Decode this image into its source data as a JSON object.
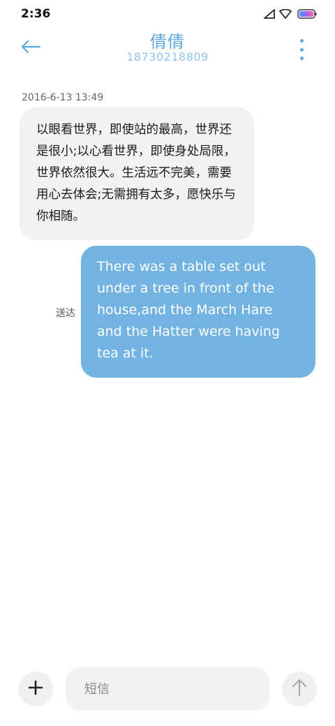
{
  "status_bar": {
    "time": "2:36",
    "icons": [
      "cellular-signal-icon",
      "wifi-icon",
      "battery-icon"
    ]
  },
  "header": {
    "contact_name": "倩倩",
    "contact_number": "18730218809",
    "back_icon": "arrow-left-icon",
    "more_icon": "more-vertical-icon"
  },
  "conversation": {
    "timestamp": "2016-6-13 13:49",
    "messages": [
      {
        "direction": "incoming",
        "text": "以眼看世界，即使站的最高，世界还是很小;以心看世界，即使身处局限，世界依然很大。生活远不完美，需要用心去体会;无需拥有太多，愿快乐与你相随。"
      },
      {
        "direction": "outgoing",
        "status": "送达",
        "text": "There was a table set out under a tree in front of the house,and the March Hare and the Hatter were having tea at it."
      }
    ]
  },
  "composer": {
    "placeholder": "短信",
    "value": "",
    "add_icon": "plus-icon",
    "send_icon": "arrow-up-icon"
  },
  "colors": {
    "accent": "#5aa9e0",
    "outgoing_bubble": "#73b3e2",
    "incoming_bubble": "#f2f2f2"
  }
}
